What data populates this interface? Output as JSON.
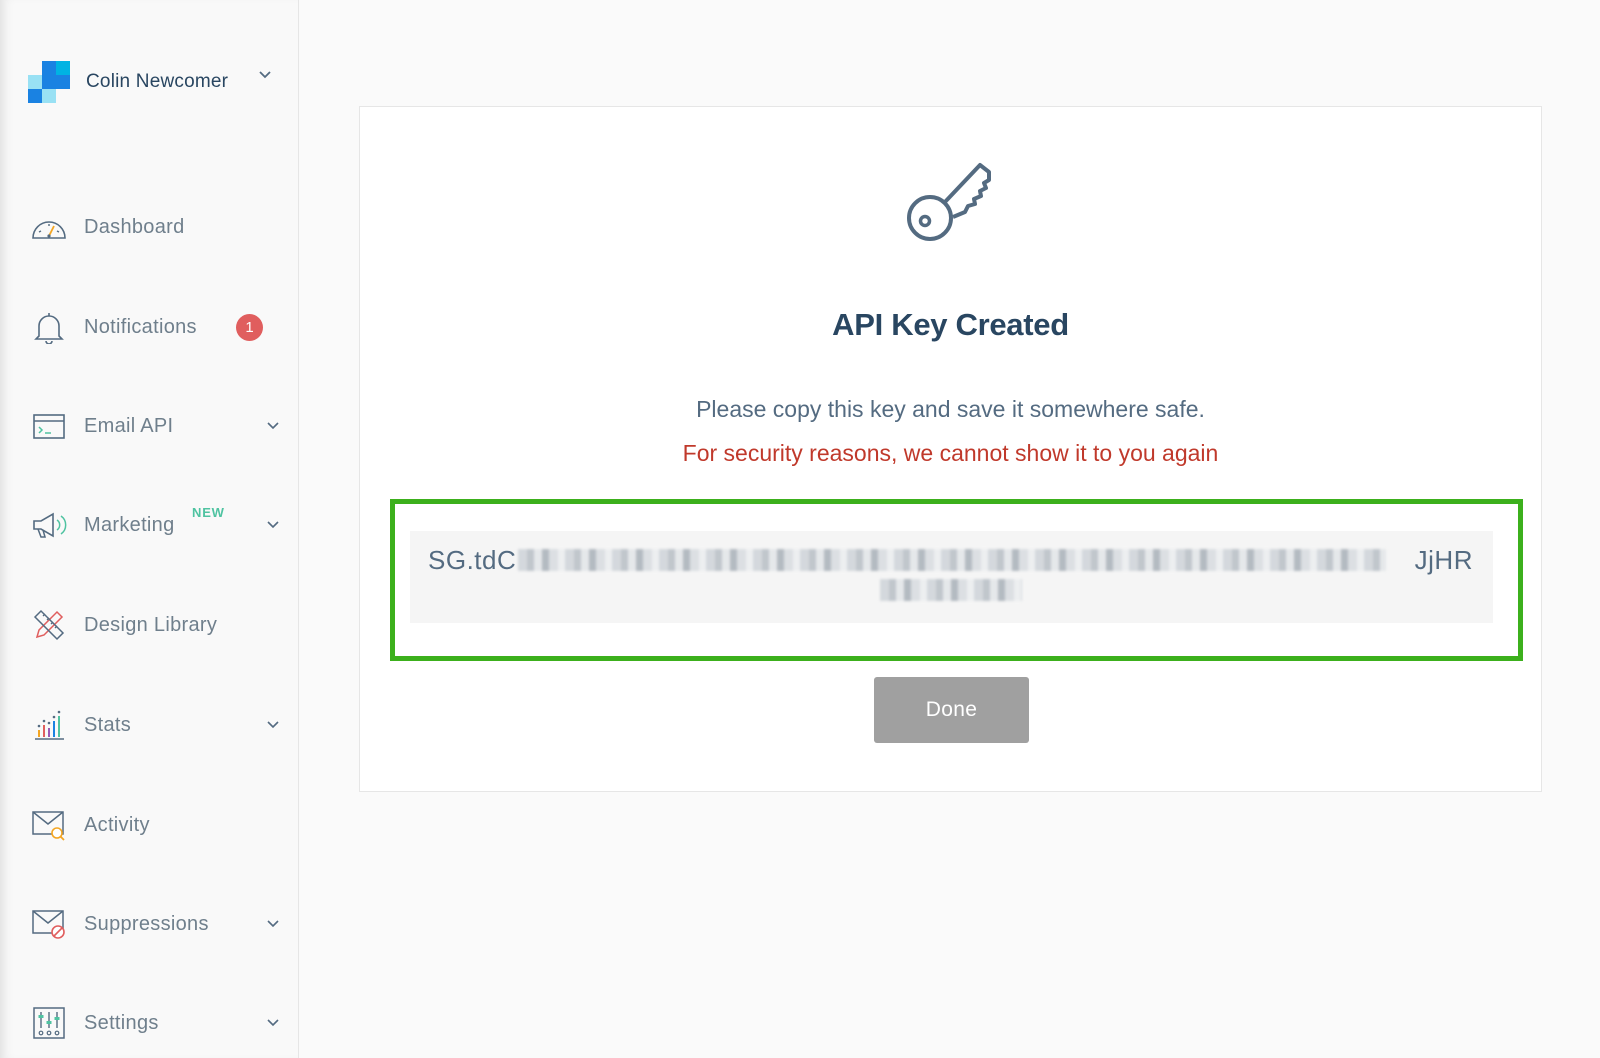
{
  "account": {
    "name": "Colin Newcomer",
    "logo_icon": "sendgrid-logo-icon"
  },
  "sidebar": {
    "items": [
      {
        "label": "Dashboard",
        "icon": "dashboard-gauge-icon",
        "has_chevron": false
      },
      {
        "label": "Notifications",
        "icon": "bell-icon",
        "badge": "1",
        "has_chevron": false
      },
      {
        "label": "Email API",
        "icon": "terminal-window-icon",
        "has_chevron": true
      },
      {
        "label": "Marketing",
        "icon": "megaphone-icon",
        "tag": "NEW",
        "has_chevron": true
      },
      {
        "label": "Design Library",
        "icon": "pencil-ruler-icon",
        "has_chevron": false
      },
      {
        "label": "Stats",
        "icon": "bar-chart-icon",
        "has_chevron": true
      },
      {
        "label": "Activity",
        "icon": "envelope-search-icon",
        "has_chevron": false
      },
      {
        "label": "Suppressions",
        "icon": "envelope-blocked-icon",
        "has_chevron": true
      },
      {
        "label": "Settings",
        "icon": "sliders-icon",
        "has_chevron": true
      }
    ]
  },
  "modal": {
    "icon": "key-icon",
    "title": "API Key Created",
    "message": "Please copy this key and save it somewhere safe.",
    "warning": "For security reasons, we cannot show it to you again",
    "key_prefix": "SG.tdC",
    "key_suffix": "JjHR",
    "done_label": "Done"
  },
  "colors": {
    "title": "#294661",
    "warning": "#c0392b",
    "highlight": "#3cb01c",
    "badge": "#e05e5e",
    "new_tag": "#4fc3a1",
    "done_button": "#a0a0a0"
  }
}
